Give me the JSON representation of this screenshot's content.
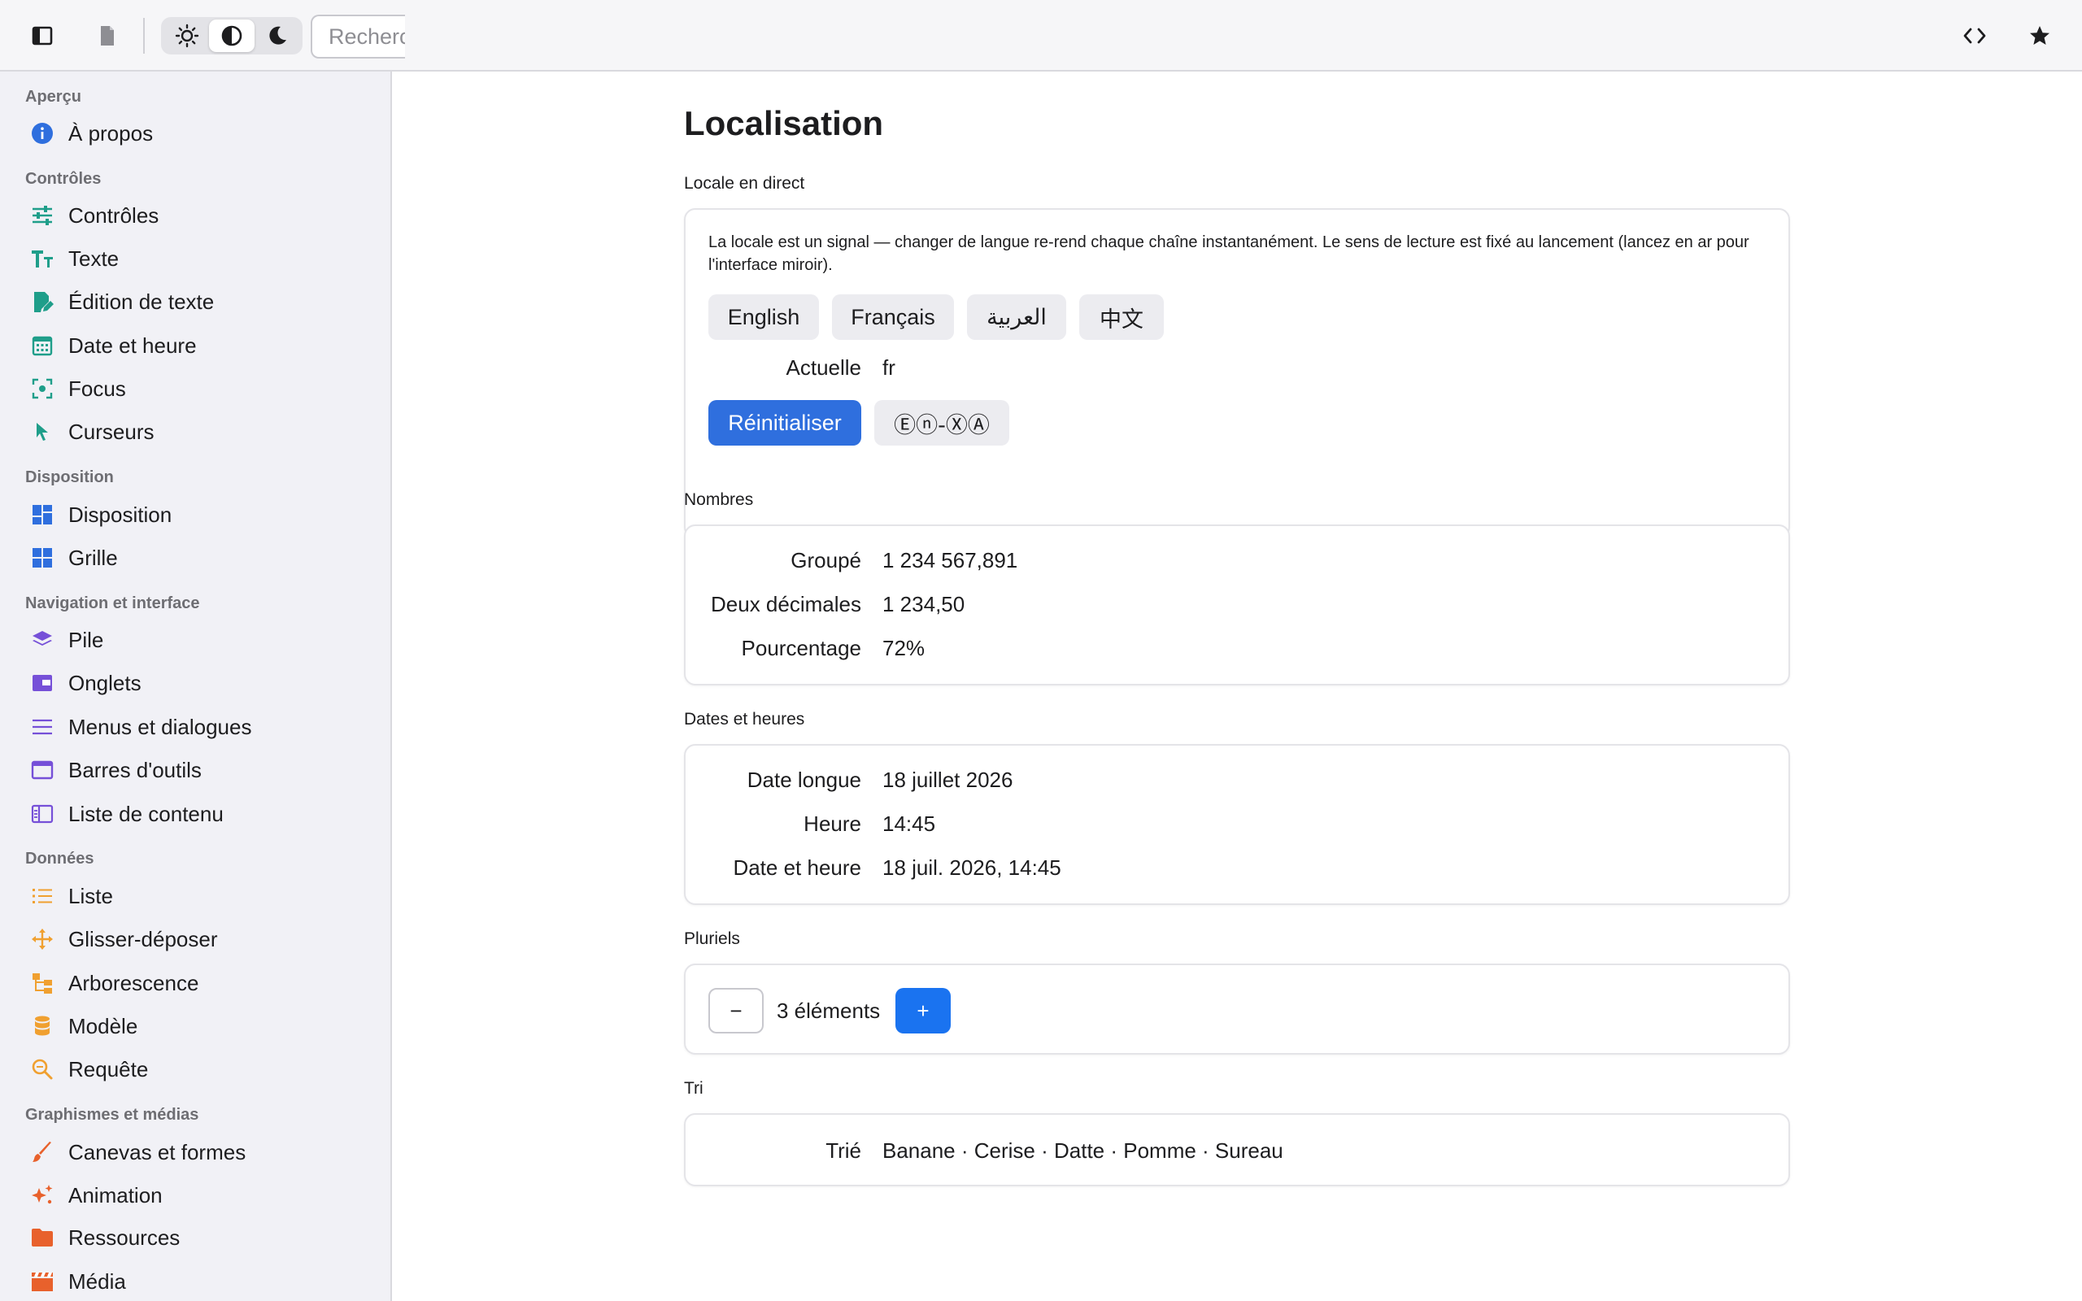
{
  "toolbar": {
    "search_placeholder": "Rechercher",
    "icons": [
      "sidebar-toggle-icon",
      "document-icon",
      "sun-icon",
      "contrast-icon",
      "moon-icon",
      "code-icon",
      "star-icon"
    ]
  },
  "sidebar": {
    "sections": [
      {
        "title": "Aperçu",
        "items": [
          {
            "label": "À propos",
            "icon": "info-icon",
            "color": "#2f6fde"
          }
        ]
      },
      {
        "title": "Contrôles",
        "items": [
          {
            "label": "Contrôles",
            "icon": "sliders-icon",
            "color": "#1f9e8a"
          },
          {
            "label": "Texte",
            "icon": "text-size-icon",
            "color": "#1f9e8a"
          },
          {
            "label": "Édition de texte",
            "icon": "edit-document-icon",
            "color": "#1f9e8a"
          },
          {
            "label": "Date et heure",
            "icon": "calendar-icon",
            "color": "#1f9e8a"
          },
          {
            "label": "Focus",
            "icon": "focus-icon",
            "color": "#1f9e8a"
          },
          {
            "label": "Curseurs",
            "icon": "cursor-icon",
            "color": "#1f9e8a"
          }
        ]
      },
      {
        "title": "Disposition",
        "items": [
          {
            "label": "Disposition",
            "icon": "layout-icon",
            "color": "#2f6fde"
          },
          {
            "label": "Grille",
            "icon": "grid-icon",
            "color": "#2f6fde"
          }
        ]
      },
      {
        "title": "Navigation et interface",
        "items": [
          {
            "label": "Pile",
            "icon": "stack-icon",
            "color": "#7650d8"
          },
          {
            "label": "Onglets",
            "icon": "tabs-icon",
            "color": "#7650d8"
          },
          {
            "label": "Menus et dialogues",
            "icon": "menu-icon",
            "color": "#7650d8"
          },
          {
            "label": "Barres d'outils",
            "icon": "toolbar-icon",
            "color": "#7650d8"
          },
          {
            "label": "Liste de contenu",
            "icon": "content-list-icon",
            "color": "#7650d8"
          }
        ]
      },
      {
        "title": "Données",
        "items": [
          {
            "label": "Liste",
            "icon": "list-icon",
            "color": "#f0a030"
          },
          {
            "label": "Glisser-déposer",
            "icon": "move-icon",
            "color": "#f0a030"
          },
          {
            "label": "Arborescence",
            "icon": "tree-icon",
            "color": "#f0a030"
          },
          {
            "label": "Modèle",
            "icon": "database-icon",
            "color": "#f0a030"
          },
          {
            "label": "Requête",
            "icon": "query-icon",
            "color": "#f0a030"
          }
        ]
      },
      {
        "title": "Graphismes et médias",
        "items": [
          {
            "label": "Canevas et formes",
            "icon": "brush-icon",
            "color": "#e8612c"
          },
          {
            "label": "Animation",
            "icon": "sparkle-icon",
            "color": "#e8612c"
          },
          {
            "label": "Ressources",
            "icon": "folder-icon",
            "color": "#e8612c"
          },
          {
            "label": "Média",
            "icon": "clapper-icon",
            "color": "#e8612c"
          }
        ]
      }
    ]
  },
  "main": {
    "title": "Localisation",
    "live_locale": {
      "label": "Locale en direct",
      "description": "La locale est un signal — changer de langue re-rend chaque chaîne instantanément. Le sens de lecture est fixé au lancement (lancez en ar pour l'interface miroir).",
      "languages": [
        "English",
        "Français",
        "العربية",
        "中文"
      ],
      "current_key": "Actuelle",
      "current_value": "fr",
      "reset_label": "Réinitialiser",
      "pseudo_label": "Ⓔⓝ-ⓍⒶ"
    },
    "numbers": {
      "label": "Nombres",
      "rows": [
        {
          "k": "Groupé",
          "v": "1 234 567,891"
        },
        {
          "k": "Deux décimales",
          "v": "1 234,50"
        },
        {
          "k": "Pourcentage",
          "v": "72%"
        }
      ]
    },
    "dates": {
      "label": "Dates et heures",
      "rows": [
        {
          "k": "Date longue",
          "v": "18 juillet 2026"
        },
        {
          "k": "Heure",
          "v": "14:45"
        },
        {
          "k": "Date et heure",
          "v": "18 juil. 2026, 14:45"
        }
      ]
    },
    "plurals": {
      "label": "Pluriels",
      "minus": "−",
      "plus": "+",
      "value": "3 éléments"
    },
    "sorting": {
      "label": "Tri",
      "key": "Trié",
      "value": "Banane · Cerise · Datte · Pomme · Sureau"
    }
  }
}
